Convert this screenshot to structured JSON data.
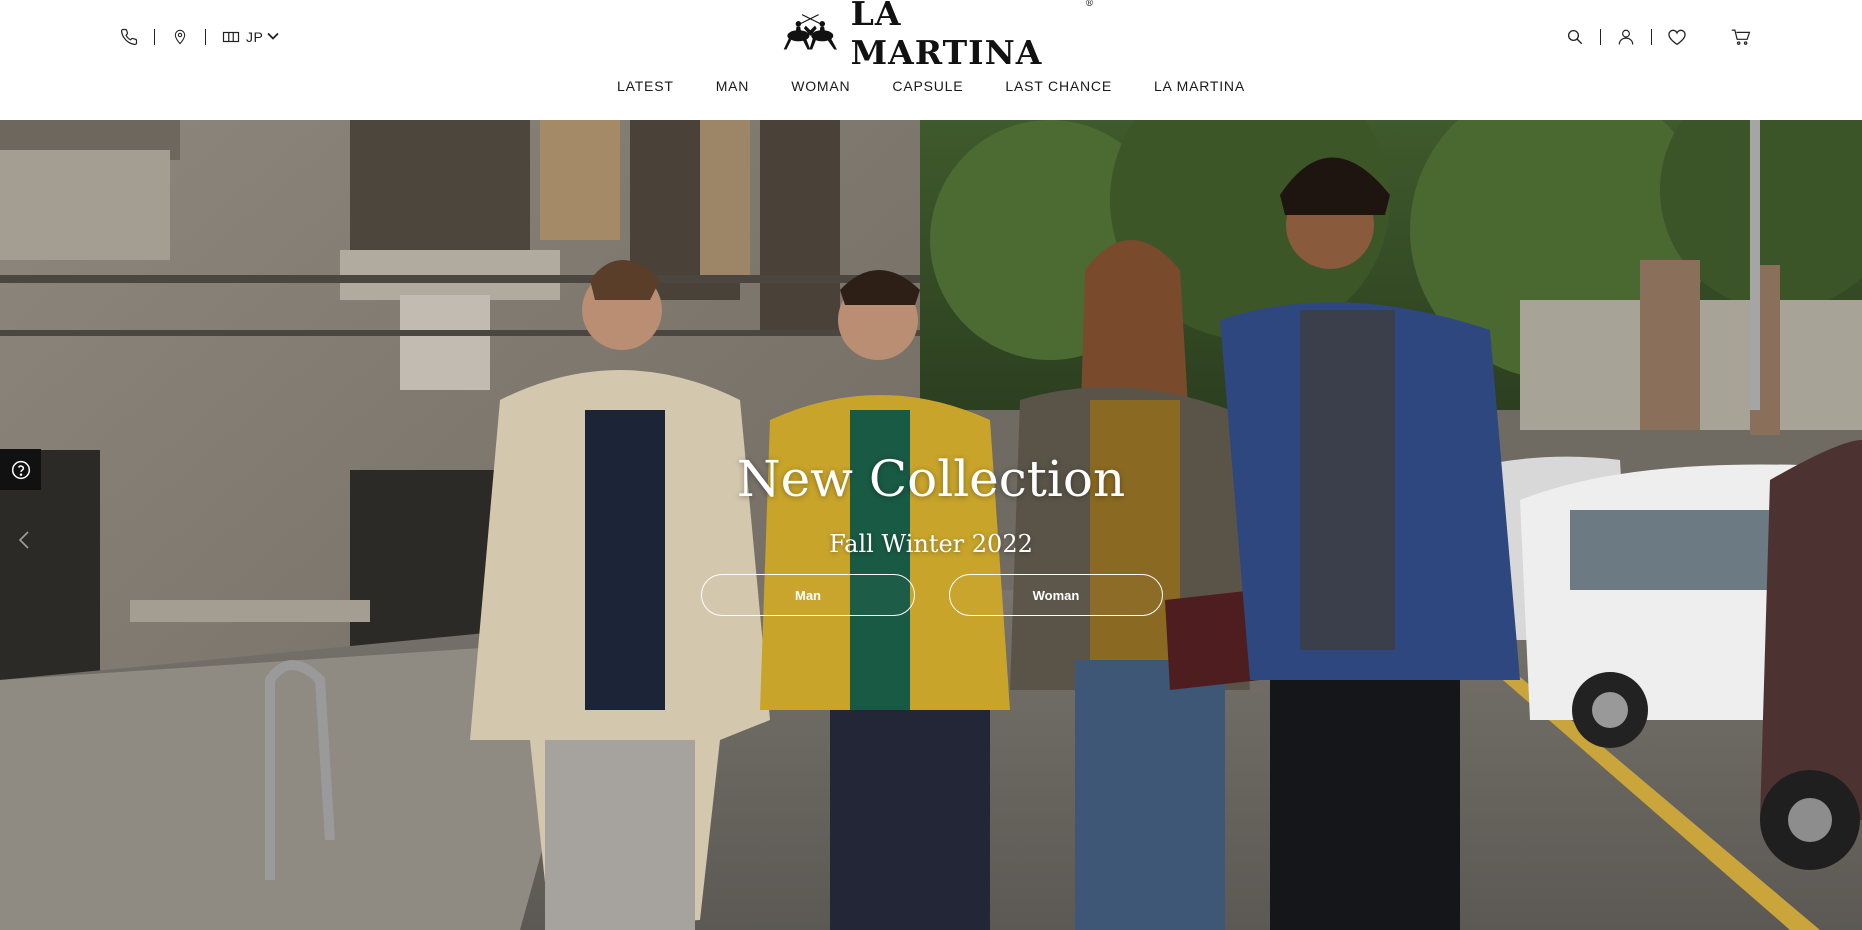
{
  "header": {
    "language": "JP",
    "brand": "LA MARTINA",
    "nav": [
      {
        "label": "LATEST"
      },
      {
        "label": "MAN"
      },
      {
        "label": "WOMAN"
      },
      {
        "label": "CAPSULE"
      },
      {
        "label": "LAST CHANCE"
      },
      {
        "label": "LA MARTINA"
      }
    ],
    "icons": {
      "left": [
        "phone-icon",
        "location-icon",
        "store-icon",
        "chevron-down-icon"
      ],
      "right": [
        "search-icon",
        "account-icon",
        "wishlist-icon",
        "cart-icon"
      ]
    }
  },
  "hero": {
    "title": "New Collection",
    "subtitle": "Fall Winter 2022",
    "buttons": {
      "man": "Man",
      "woman": "Woman"
    }
  },
  "colors": {
    "header_bg": "#ffffff",
    "text": "#1a1a1a",
    "hero_text": "#ffffff",
    "help_bg": "#111111"
  }
}
